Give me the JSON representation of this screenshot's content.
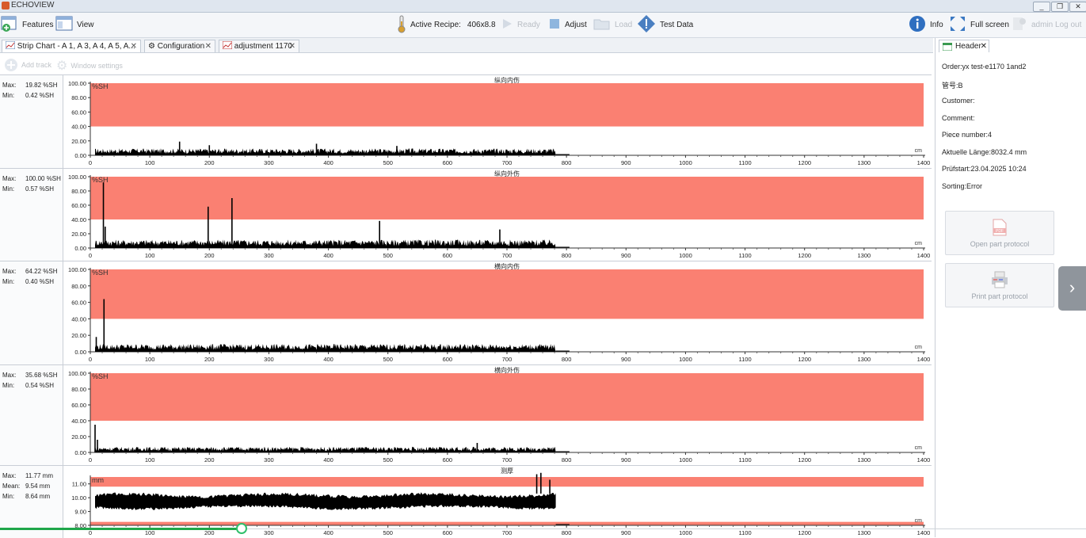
{
  "window": {
    "title": "ECHOVIEW",
    "controls": [
      "_",
      "❐",
      "✕"
    ]
  },
  "toolbar": {
    "features_label": "Features",
    "view_label": "View",
    "active_recipe_label": "Active Recipe:",
    "active_recipe_value": "406x8.8",
    "ready_label": "Ready",
    "adjust_label": "Adjust",
    "load_label": "Load",
    "test_data_label": "Test Data",
    "info_label": "Info",
    "fullscreen_label": "Full screen",
    "logout_label": "admin Log out"
  },
  "tabs": [
    {
      "label": "Strip Chart - A 1, A 3, A 4, A 5, A..."
    },
    {
      "label": "Configuration"
    },
    {
      "label": "adjustment 1170"
    }
  ],
  "subtoolbar": {
    "add_track_label": "Add track",
    "window_settings_label": "Window settings"
  },
  "tracks": [
    {
      "stats": [
        {
          "label": "Max:",
          "value": "19.82 %SH"
        },
        {
          "label": "Min:",
          "value": "0.42 %SH"
        }
      ],
      "chart_data": {
        "type": "area",
        "title": "纵向内伤",
        "unit_label": "%SH",
        "xunit": "cm",
        "xlim": [
          0,
          1400
        ],
        "ylim": [
          0,
          100
        ],
        "xticks": [
          0,
          100,
          200,
          300,
          400,
          500,
          600,
          700,
          800,
          900,
          1000,
          1100,
          1200,
          1300,
          1400
        ],
        "yticks": [
          "0.00",
          "20.00",
          "40.00",
          "60.00",
          "80.00",
          "100.00"
        ],
        "threshold_band": [
          40,
          100
        ],
        "data_range": [
          8,
          782
        ],
        "baseline_level": 8,
        "spikes": [
          [
            150,
            19
          ],
          [
            200,
            14
          ],
          [
            380,
            16
          ],
          [
            515,
            13
          ]
        ]
      }
    },
    {
      "stats": [
        {
          "label": "Max:",
          "value": "100.00 %SH"
        },
        {
          "label": "Min:",
          "value": "0.57 %SH"
        }
      ],
      "chart_data": {
        "type": "area",
        "title": "纵向外伤",
        "unit_label": "%SH",
        "xunit": "cm",
        "xlim": [
          0,
          1400
        ],
        "ylim": [
          0,
          100
        ],
        "xticks": [
          0,
          100,
          200,
          300,
          400,
          500,
          600,
          700,
          800,
          900,
          1000,
          1100,
          1200,
          1300,
          1400
        ],
        "yticks": [
          "0.00",
          "20.00",
          "40.00",
          "60.00",
          "80.00",
          "100.00"
        ],
        "threshold_band": [
          40,
          100
        ],
        "data_range": [
          8,
          782
        ],
        "baseline_level": 10,
        "spikes": [
          [
            22,
            92
          ],
          [
            25,
            30
          ],
          [
            198,
            58
          ],
          [
            238,
            70
          ],
          [
            486,
            38
          ],
          [
            688,
            26
          ]
        ]
      }
    },
    {
      "stats": [
        {
          "label": "Max:",
          "value": "64.22 %SH"
        },
        {
          "label": "Min:",
          "value": "0.40 %SH"
        }
      ],
      "chart_data": {
        "type": "area",
        "title": "横向内伤",
        "unit_label": "%SH",
        "xunit": "cm",
        "xlim": [
          0,
          1400
        ],
        "ylim": [
          0,
          100
        ],
        "xticks": [
          0,
          100,
          200,
          300,
          400,
          500,
          600,
          700,
          800,
          900,
          1000,
          1100,
          1200,
          1300,
          1400
        ],
        "yticks": [
          "0.00",
          "20.00",
          "40.00",
          "60.00",
          "80.00",
          "100.00"
        ],
        "threshold_band": [
          40,
          100
        ],
        "data_range": [
          8,
          782
        ],
        "baseline_level": 8,
        "spikes": [
          [
            10,
            18
          ],
          [
            23,
            64
          ]
        ]
      }
    },
    {
      "stats": [
        {
          "label": "Max:",
          "value": "35.68 %SH"
        },
        {
          "label": "Min:",
          "value": "0.54 %SH"
        }
      ],
      "chart_data": {
        "type": "area",
        "title": "横向外伤",
        "unit_label": "%SH",
        "xunit": "cm",
        "xlim": [
          0,
          1400
        ],
        "ylim": [
          0,
          100
        ],
        "xticks": [
          0,
          100,
          200,
          300,
          400,
          500,
          600,
          700,
          800,
          900,
          1000,
          1100,
          1200,
          1300,
          1400
        ],
        "yticks": [
          "0.00",
          "20.00",
          "40.00",
          "60.00",
          "80.00",
          "100.00"
        ],
        "threshold_band": [
          40,
          100
        ],
        "data_range": [
          8,
          782
        ],
        "baseline_level": 6,
        "spikes": [
          [
            8,
            35
          ],
          [
            12,
            16
          ],
          [
            650,
            12
          ]
        ]
      }
    },
    {
      "stats": [
        {
          "label": "Max:",
          "value": "11.77 mm"
        },
        {
          "label": "Mean:",
          "value": "9.54 mm"
        },
        {
          "label": "Min:",
          "value": "8.64 mm"
        }
      ],
      "chart_data": {
        "type": "area",
        "title": "测厚",
        "unit_label": "mm",
        "xunit": "cm",
        "xlim": [
          0,
          1400
        ],
        "ylim": [
          8,
          11.5
        ],
        "xticks": [
          0,
          100,
          200,
          300,
          400,
          500,
          600,
          700,
          800,
          900,
          1000,
          1100,
          1200,
          1300,
          1400
        ],
        "yticks": [
          "8.00",
          "9.00",
          "10.00",
          "11.00"
        ],
        "threshold_bands": [
          [
            10.8,
            11.5
          ],
          [
            8,
            8.25
          ]
        ],
        "data_range": [
          8,
          782
        ],
        "band_low": 9.2,
        "band_high": 10.3,
        "spikes": [
          [
            750,
            11.7
          ],
          [
            757,
            11.8
          ],
          [
            772,
            11.3
          ]
        ]
      }
    }
  ],
  "right_panel": {
    "tab_label": "Header",
    "lines": [
      {
        "label": "Order:",
        "value": "yx test-e1170 1and2"
      },
      {
        "label": "管号:",
        "value": "B"
      },
      {
        "label": "Customer:",
        "value": ""
      },
      {
        "label": "Comment:",
        "value": ""
      },
      {
        "label": "Piece number:",
        "value": "4"
      },
      {
        "label": "Aktuelle Länge:",
        "value": "8032.4 mm"
      },
      {
        "label": "Prüfstart:",
        "value": "23.04.2025 10:24"
      },
      {
        "label": "Sorting:",
        "value": "Error"
      }
    ],
    "open_protocol_label": "Open part protocol",
    "print_protocol_label": "Print part protocol",
    "pdf_badge": "PDF"
  },
  "progress": {
    "fraction": 0.223
  },
  "colors": {
    "threshold": "#fa8072",
    "signal": "#000000",
    "accent": "#1fa64a"
  }
}
